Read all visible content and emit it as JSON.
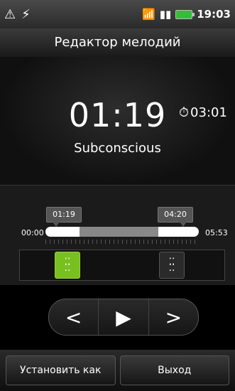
{
  "statusbar": {
    "time": "19:03",
    "signal_icon": "signal-bars-icon",
    "wifi_icon": "wifi-icon",
    "battery_icon": "battery-icon",
    "notif_icons": [
      "ringtone-triangle-icon",
      "usb-icon"
    ]
  },
  "header": {
    "title": "Редактор мелодий"
  },
  "playback": {
    "current_time": "01:19",
    "duration": "03:01",
    "song_title": "Subconscious"
  },
  "editor": {
    "start_marker": "01:19",
    "end_marker": "04:20",
    "range_start": "00:00",
    "range_end": "05:53",
    "selection": {
      "start_fraction": 0.224,
      "end_fraction": 0.737
    }
  },
  "controls": {
    "prev_icon": "chevron-left-icon",
    "play_icon": "play-icon",
    "next_icon": "chevron-right-icon"
  },
  "buttons": {
    "set_as": "Установить как",
    "exit": "Выход"
  },
  "colors": {
    "accent": "#78c020"
  }
}
